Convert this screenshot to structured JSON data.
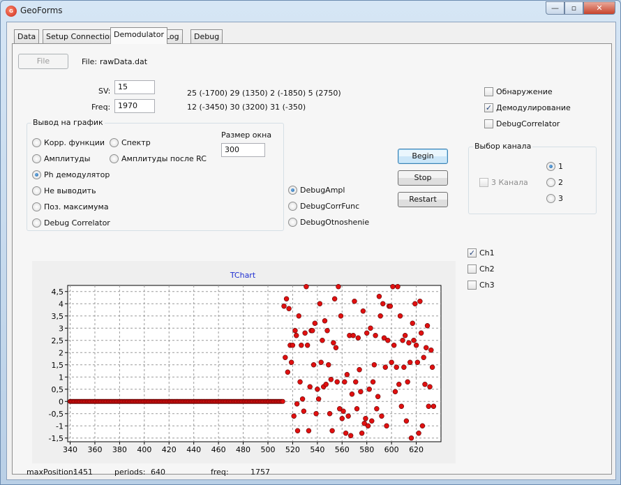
{
  "window": {
    "title": "GeoForms",
    "icon": "app-logo-icon",
    "min_glyph": "—",
    "max_glyph": "▫",
    "close_glyph": "✕"
  },
  "tabs": [
    {
      "label": "Data"
    },
    {
      "label": "Setup Connection"
    },
    {
      "label": "Demodulator",
      "active": true
    },
    {
      "label": "Log"
    },
    {
      "label": "Debug"
    }
  ],
  "file": {
    "button_label": "File",
    "label": "File:",
    "value": "rawData.dat"
  },
  "params": {
    "sv_label": "SV:",
    "sv_value": "15",
    "freq_label": "Freq:",
    "freq_value": "1970",
    "sat_line1": "25 (-1700) 29 (1350) 2 (-1850) 5 (2750)",
    "sat_line2": "12 (-3450) 30 (3200) 31 (-350)"
  },
  "output_group": {
    "title": "Вывод на график",
    "options_left": [
      {
        "label": "Корр. функции",
        "selected": false
      },
      {
        "label": "Амплитуды",
        "selected": false
      },
      {
        "label": "Ph демодулятор",
        "selected": true
      },
      {
        "label": "Не выводить",
        "selected": false
      },
      {
        "label": "Поз. максимума",
        "selected": false
      },
      {
        "label": "Debug Correlator",
        "selected": false
      }
    ],
    "options_right": [
      {
        "label": "Спектр",
        "selected": false
      },
      {
        "label": "Амплитуды после RC",
        "selected": false
      }
    ],
    "window_size_label": "Размер окна",
    "window_size_value": "300"
  },
  "debug_options": [
    {
      "label": "DebugAmpl",
      "selected": true
    },
    {
      "label": "DebugCorrFunc",
      "selected": false
    },
    {
      "label": "DebugOtnoshenie",
      "selected": false
    }
  ],
  "actions": {
    "begin": "Begin",
    "stop": "Stop",
    "restart": "Restart"
  },
  "checks": [
    {
      "label": "Обнаружение",
      "checked": false
    },
    {
      "label": "Демодулирование",
      "checked": true
    },
    {
      "label": "DebugCorrelator",
      "checked": false
    }
  ],
  "channel_group": {
    "title": "Выбор канала",
    "three_channels_label": "3 Канала",
    "three_channels_checked": false,
    "channels": [
      {
        "label": "1",
        "selected": true
      },
      {
        "label": "2",
        "selected": false
      },
      {
        "label": "3",
        "selected": false
      }
    ]
  },
  "channel_checks": [
    {
      "label": "Ch1",
      "checked": true
    },
    {
      "label": "Ch2",
      "checked": false
    },
    {
      "label": "Ch3",
      "checked": false
    }
  ],
  "status": {
    "max_position_label": "maxPosition:",
    "max_position_value": "1451",
    "periods_label": "periods:",
    "periods_value": "640",
    "freq_label": "freq:",
    "freq_value": "1757"
  },
  "chart_data": {
    "type": "scatter",
    "title": "TChart",
    "xlabel": "",
    "ylabel": "",
    "xlim": [
      338,
      640
    ],
    "ylim": [
      -1.65,
      4.75
    ],
    "x_ticks": [
      340,
      360,
      380,
      400,
      420,
      440,
      460,
      480,
      500,
      520,
      540,
      560,
      580,
      600,
      620
    ],
    "y_ticks": [
      "4,5",
      "4",
      "3,5",
      "3",
      "2,5",
      "2",
      "1,5",
      "1",
      "0,5",
      "0",
      "-0,5",
      "-1",
      "-1,5"
    ],
    "y_tick_values": [
      4.5,
      4,
      3.5,
      3,
      2.5,
      2,
      1.5,
      1,
      0.5,
      0,
      -0.5,
      -1,
      -1.5
    ],
    "grid": true,
    "marker_color": "#e01010",
    "flat_segment": {
      "x_from": 340,
      "x_to": 512,
      "step": 1,
      "y": 0
    },
    "points": [
      [
        513,
        3.9
      ],
      [
        514,
        1.8
      ],
      [
        515,
        4.2
      ],
      [
        516,
        1.2
      ],
      [
        517,
        3.8
      ],
      [
        518,
        2.3
      ],
      [
        519,
        1.6
      ],
      [
        520,
        2.3
      ],
      [
        521,
        -0.6
      ],
      [
        522,
        2.9
      ],
      [
        523,
        2.7
      ],
      [
        523.5,
        -0.1
      ],
      [
        524,
        -1.2
      ],
      [
        525,
        3.5
      ],
      [
        526,
        0.8
      ],
      [
        527,
        2.3
      ],
      [
        528,
        0.1
      ],
      [
        529,
        -0.4
      ],
      [
        530,
        2.8
      ],
      [
        531,
        4.7
      ],
      [
        532,
        2.3
      ],
      [
        533,
        -1.2
      ],
      [
        534,
        0.6
      ],
      [
        535,
        2.9
      ],
      [
        536,
        2.9
      ],
      [
        537,
        1.5
      ],
      [
        538,
        3.2
      ],
      [
        539,
        -0.5
      ],
      [
        540,
        0.5
      ],
      [
        541,
        0.1
      ],
      [
        542,
        4.0
      ],
      [
        543,
        1.6
      ],
      [
        544,
        2.5
      ],
      [
        545,
        0.6
      ],
      [
        546,
        3.3
      ],
      [
        547,
        0.7
      ],
      [
        548,
        2.9
      ],
      [
        549,
        1.5
      ],
      [
        550,
        -0.5
      ],
      [
        551,
        0.9
      ],
      [
        552,
        -1.2
      ],
      [
        553,
        2.4
      ],
      [
        554,
        4.2
      ],
      [
        555,
        2.2
      ],
      [
        556,
        0.8
      ],
      [
        557,
        4.7
      ],
      [
        558,
        -0.3
      ],
      [
        559,
        3.5
      ],
      [
        560,
        -0.7
      ],
      [
        561,
        -0.4
      ],
      [
        562,
        0.8
      ],
      [
        563,
        -1.3
      ],
      [
        564,
        1.1
      ],
      [
        565,
        -0.6
      ],
      [
        566,
        2.7
      ],
      [
        567,
        -1.4
      ],
      [
        568,
        0.3
      ],
      [
        569,
        2.7
      ],
      [
        570,
        4.1
      ],
      [
        571,
        0.8
      ],
      [
        572,
        -0.3
      ],
      [
        573,
        2.6
      ],
      [
        574,
        1.3
      ],
      [
        575,
        0.4
      ],
      [
        576,
        -1.3
      ],
      [
        577,
        3.7
      ],
      [
        578,
        -0.9
      ],
      [
        579,
        -0.7
      ],
      [
        580,
        2.8
      ],
      [
        581,
        -1.0
      ],
      [
        582,
        0.5
      ],
      [
        583,
        3.0
      ],
      [
        584,
        -0.8
      ],
      [
        585,
        0.8
      ],
      [
        586,
        1.5
      ],
      [
        587,
        2.7
      ],
      [
        588,
        -0.3
      ],
      [
        589,
        0.2
      ],
      [
        590,
        4.3
      ],
      [
        591,
        3.5
      ],
      [
        592,
        -0.6
      ],
      [
        593,
        4.0
      ],
      [
        594,
        2.6
      ],
      [
        595,
        1.4
      ],
      [
        596,
        -1.0
      ],
      [
        597,
        2.5
      ],
      [
        598,
        3.9
      ],
      [
        599,
        3.9
      ],
      [
        600,
        1.6
      ],
      [
        601,
        4.7
      ],
      [
        602,
        2.3
      ],
      [
        603,
        0.4
      ],
      [
        604,
        1.4
      ],
      [
        605,
        4.7
      ],
      [
        606,
        0.7
      ],
      [
        607,
        3.5
      ],
      [
        608,
        -0.2
      ],
      [
        609,
        2.5
      ],
      [
        610,
        1.4
      ],
      [
        611,
        2.7
      ],
      [
        612,
        -0.8
      ],
      [
        613,
        0.8
      ],
      [
        614,
        2.4
      ],
      [
        615,
        1.6
      ],
      [
        616,
        -1.5
      ],
      [
        617,
        3.2
      ],
      [
        618,
        2.5
      ],
      [
        619,
        4.0
      ],
      [
        620,
        2.3
      ],
      [
        621,
        1.6
      ],
      [
        622,
        -1.3
      ],
      [
        623,
        4.1
      ],
      [
        624,
        2.8
      ],
      [
        625,
        -1.0
      ],
      [
        626,
        1.8
      ],
      [
        627,
        0.7
      ],
      [
        628,
        2.2
      ],
      [
        629,
        3.1
      ],
      [
        630,
        -0.2
      ],
      [
        631,
        0.6
      ],
      [
        632,
        2.1
      ],
      [
        633,
        1.4
      ],
      [
        634,
        -0.2
      ]
    ]
  }
}
